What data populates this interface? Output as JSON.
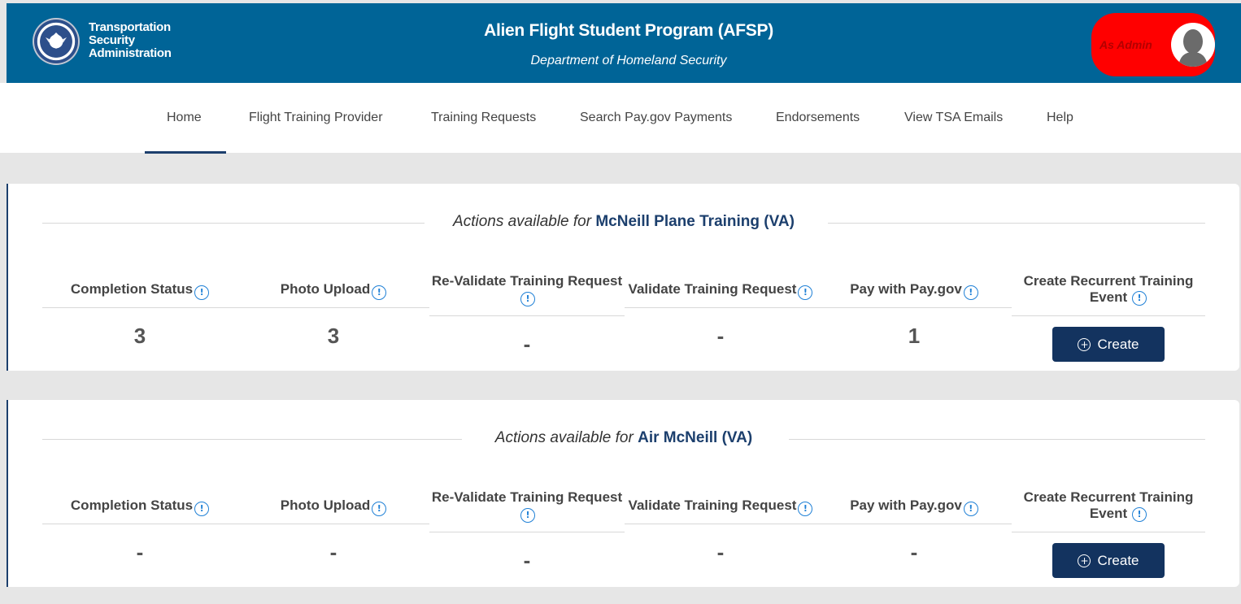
{
  "header": {
    "org_lines": [
      "Transportation",
      "Security",
      "Administration"
    ],
    "title": "Alien Flight Student Program (AFSP)",
    "subtitle": "Department of Homeland Security",
    "user_label": "As Admin",
    "user_pill_color": "#ff0000",
    "bar_color": "#006497"
  },
  "nav": {
    "items": [
      "Home",
      "Flight Training Provider",
      "Training Requests",
      "Search Pay.gov Payments",
      "Endorsements",
      "View TSA Emails",
      "Help"
    ],
    "active": "Home"
  },
  "cards": [
    {
      "heading_prefix": "Actions available for",
      "provider": "McNeill Plane Training (VA)",
      "columns": [
        {
          "title": "Completion Status",
          "value": "3"
        },
        {
          "title": "Photo Upload",
          "value": "3"
        },
        {
          "title": "Re-Validate Training Request",
          "value": "-"
        },
        {
          "title": "Validate Training Request",
          "value": "-"
        },
        {
          "title": "Pay with Pay.gov",
          "value": "1"
        },
        {
          "title": "Create Recurrent Training Event",
          "button": "Create"
        }
      ]
    },
    {
      "heading_prefix": "Actions available for",
      "provider": "Air McNeill (VA)",
      "columns": [
        {
          "title": "Completion Status",
          "value": "-"
        },
        {
          "title": "Photo Upload",
          "value": "-"
        },
        {
          "title": "Re-Validate Training Request",
          "value": "-"
        },
        {
          "title": "Validate Training Request",
          "value": "-"
        },
        {
          "title": "Pay with Pay.gov",
          "value": "-"
        },
        {
          "title": "Create Recurrent Training Event",
          "button": "Create"
        }
      ]
    }
  ],
  "icons": {
    "info": "info-circle-icon",
    "plus": "plus-circle-icon",
    "info_color": "#1f80d6",
    "button_color": "#13335f",
    "accent": "#1c3f6d"
  }
}
